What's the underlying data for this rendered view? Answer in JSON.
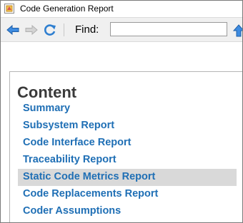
{
  "window": {
    "title": "Code Generation Report"
  },
  "toolbar": {
    "back_icon": "back-arrow-icon",
    "forward_icon": "forward-arrow-icon",
    "refresh_icon": "refresh-icon",
    "find_label": "Find:",
    "find_value": "",
    "find_up_icon": "find-previous-icon",
    "accent_color": "#2f7fd0"
  },
  "content": {
    "heading": "Content",
    "link_color": "#1f6fb5",
    "selected_background": "#d9d9d9",
    "items": [
      {
        "label": "Summary",
        "selected": false
      },
      {
        "label": "Subsystem Report",
        "selected": false
      },
      {
        "label": "Code Interface Report",
        "selected": false
      },
      {
        "label": "Traceability Report",
        "selected": false
      },
      {
        "label": "Static Code Metrics Report",
        "selected": true
      },
      {
        "label": "Code Replacements Report",
        "selected": false
      },
      {
        "label": "Coder Assumptions",
        "selected": false
      }
    ]
  }
}
